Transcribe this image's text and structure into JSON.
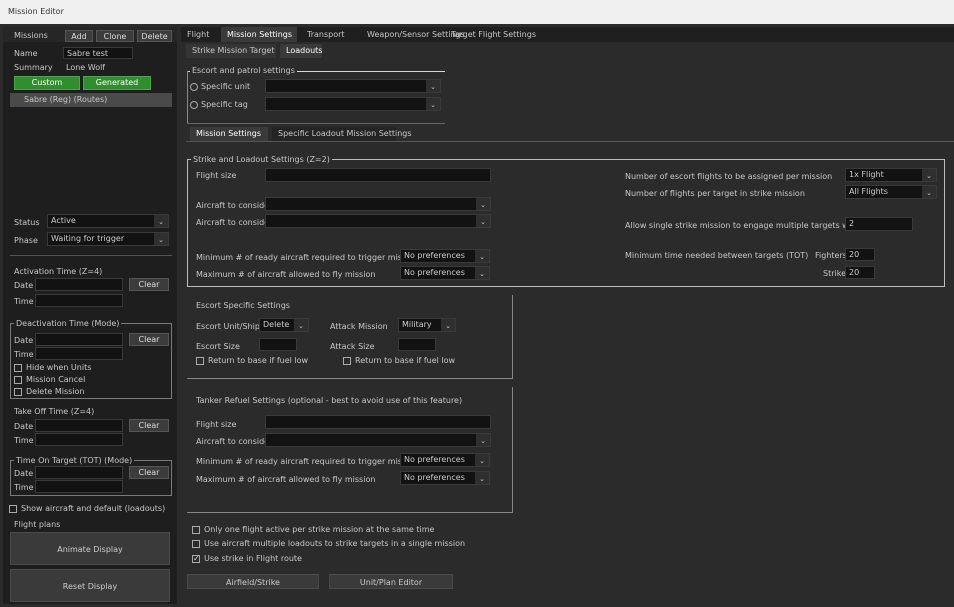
{
  "window": {
    "title": "Mission Editor"
  },
  "left": {
    "mission_label": "Missions",
    "buttons": {
      "add": "Add",
      "clone": "Clone",
      "delete": "Delete"
    },
    "name_label": "Name",
    "name_value": "Sabre test",
    "summary_label": "Summary",
    "summary_value": "Lone Wolf",
    "custom": "Custom",
    "generated": "Generated",
    "list_item": "Sabre (Reg) (Routes)",
    "status_label": "Status",
    "status_value": "Active",
    "phase_label": "Phase",
    "phase_value": "Waiting for trigger",
    "activation": {
      "title": "Activation Time (Z=4)",
      "date": "Date",
      "time": "Time",
      "clear": "Clear"
    },
    "deactivation": {
      "title": "Deactivation Time (Mode)",
      "date": "Date",
      "time": "Time",
      "clear": "Clear",
      "opt1": "Hide when Units",
      "opt2": "Mission Cancel",
      "opt3": "Delete Mission"
    },
    "take_off": {
      "title": "Take Off Time (Z=4)",
      "date": "Date",
      "time": "Time",
      "clear": "Clear"
    },
    "time_on_target": {
      "title": "Time On Target (TOT) (Mode)",
      "date": "Date",
      "time": "Time",
      "clear": "Clear"
    },
    "show_details": "Show aircraft and default (loadouts)",
    "flight_plans": "Flight plans",
    "animate": "Animate Display",
    "reset": "Reset Display"
  },
  "tabs": [
    "Flight",
    "Mission Settings",
    "Transport",
    "Weapon/Sensor Settings",
    "Target Flight Settings"
  ],
  "subtabs": [
    "Strike Mission Target",
    "Loadouts"
  ],
  "escort": {
    "title": "Escort and patrol settings",
    "opt1": "Specific unit",
    "opt2": "Specific tag"
  },
  "subtabs2": [
    "Mission Settings",
    "Specific Loadout Mission Settings"
  ],
  "strike": {
    "title": "Strike and Loadout Settings (Z=2)",
    "flight_size": "Flight size",
    "aircraft_label1": "Aircraft to consider",
    "aircraft_label2": "Aircraft to consider",
    "min_ready": "Minimum # of ready aircraft required to trigger mission",
    "max_launch": "Maximum # of aircraft allowed to fly mission",
    "no_pref": "No preferences",
    "escort_flights": "Number of escort flights to be assigned per mission",
    "escort_flights_val": "1x Flight",
    "flights_per_target": "Number of flights per target in strike mission",
    "flights_per_target_val": "All Flights",
    "multiple_targets": "Allow single strike mission to engage multiple targets within range",
    "multiple_targets_val": "2",
    "tot_label": "Minimum time needed between targets (TOT)",
    "fighters_label": "Fighters",
    "fighters_val": "20",
    "strike_label": "Strike",
    "strike_val": "20"
  },
  "escort_settings": {
    "title": "Escort Specific Settings",
    "escort_unit": "Escort Unit/Ship",
    "escort_unit_val": "Delete",
    "attack_mission": "Attack Mission",
    "attack_mission_val": "Military",
    "escort_size": "Escort Size",
    "attack_size": "Attack Size",
    "rtb_escort": "Return to base if fuel low",
    "rtb_attack": "Return to base if fuel low"
  },
  "tanker": {
    "title": "Tanker Refuel Settings (optional - best to avoid use of this feature)",
    "flight_size": "Flight size",
    "aircraft": "Aircraft to consider",
    "min_ready": "Minimum # of ready aircraft required to trigger mission",
    "max_launch": "Maximum # of aircraft allowed to fly mission",
    "no_pref": "No preferences"
  },
  "options": [
    {
      "label": "Only one flight active per strike mission at the same time",
      "checked": false
    },
    {
      "label": "Use aircraft multiple loadouts to strike targets in a single mission",
      "checked": false
    },
    {
      "label": "Use strike in Flight route",
      "checked": true
    }
  ],
  "bottom": {
    "left": "Airfield/Strike",
    "right": "Unit/Plan Editor"
  }
}
